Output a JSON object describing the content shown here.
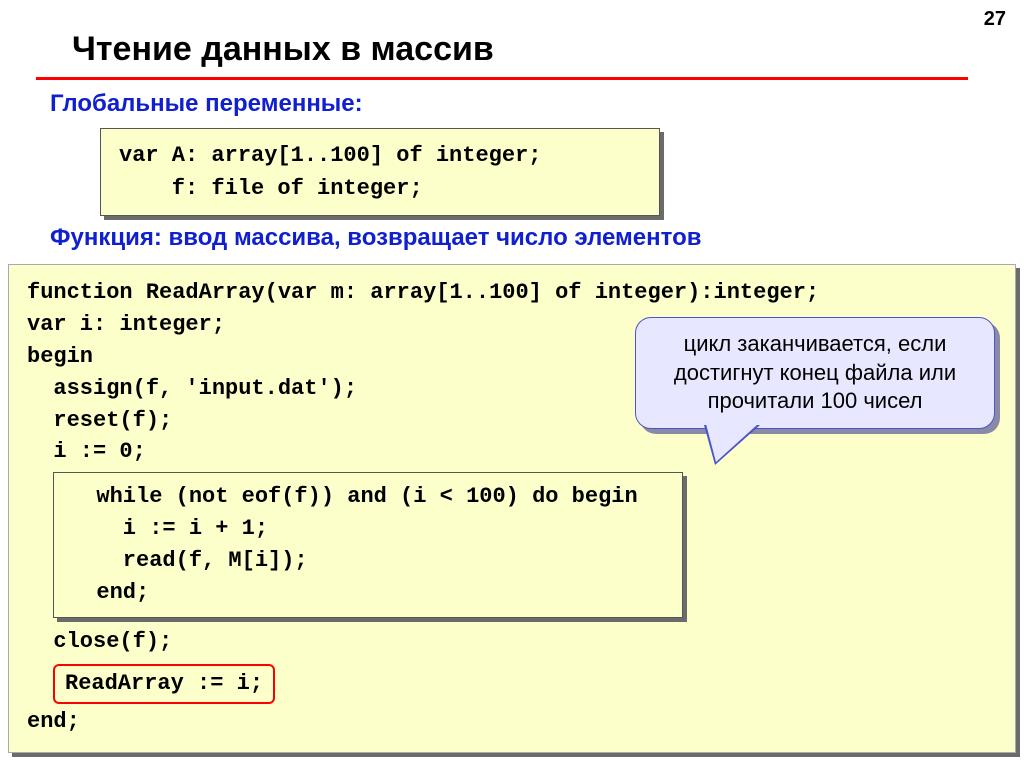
{
  "page_number": "27",
  "title": "Чтение данных в массив",
  "subheading_globals": "Глобальные переменные:",
  "globals_code": "var A: array[1..100] of integer;\n    f: file of integer;",
  "subheading_func": "Функция: ввод массива, возвращает число элементов",
  "func_head": "function ReadArray(var m: array[1..100] of integer):integer;\nvar i: integer;\nbegin\n  assign(f, 'input.dat');\n  reset(f);\n  i := 0;",
  "while_block": "  while (not eof(f)) and (i < 100) do begin\n    i := i + 1;\n    read(f, M[i]);\n  end;",
  "close_line": "  close(f);",
  "result_line": "ReadArray := i;",
  "end_line": "end;",
  "callout_text": "цикл заканчивается, если достигнут конец файла или прочитали 100 чисел"
}
